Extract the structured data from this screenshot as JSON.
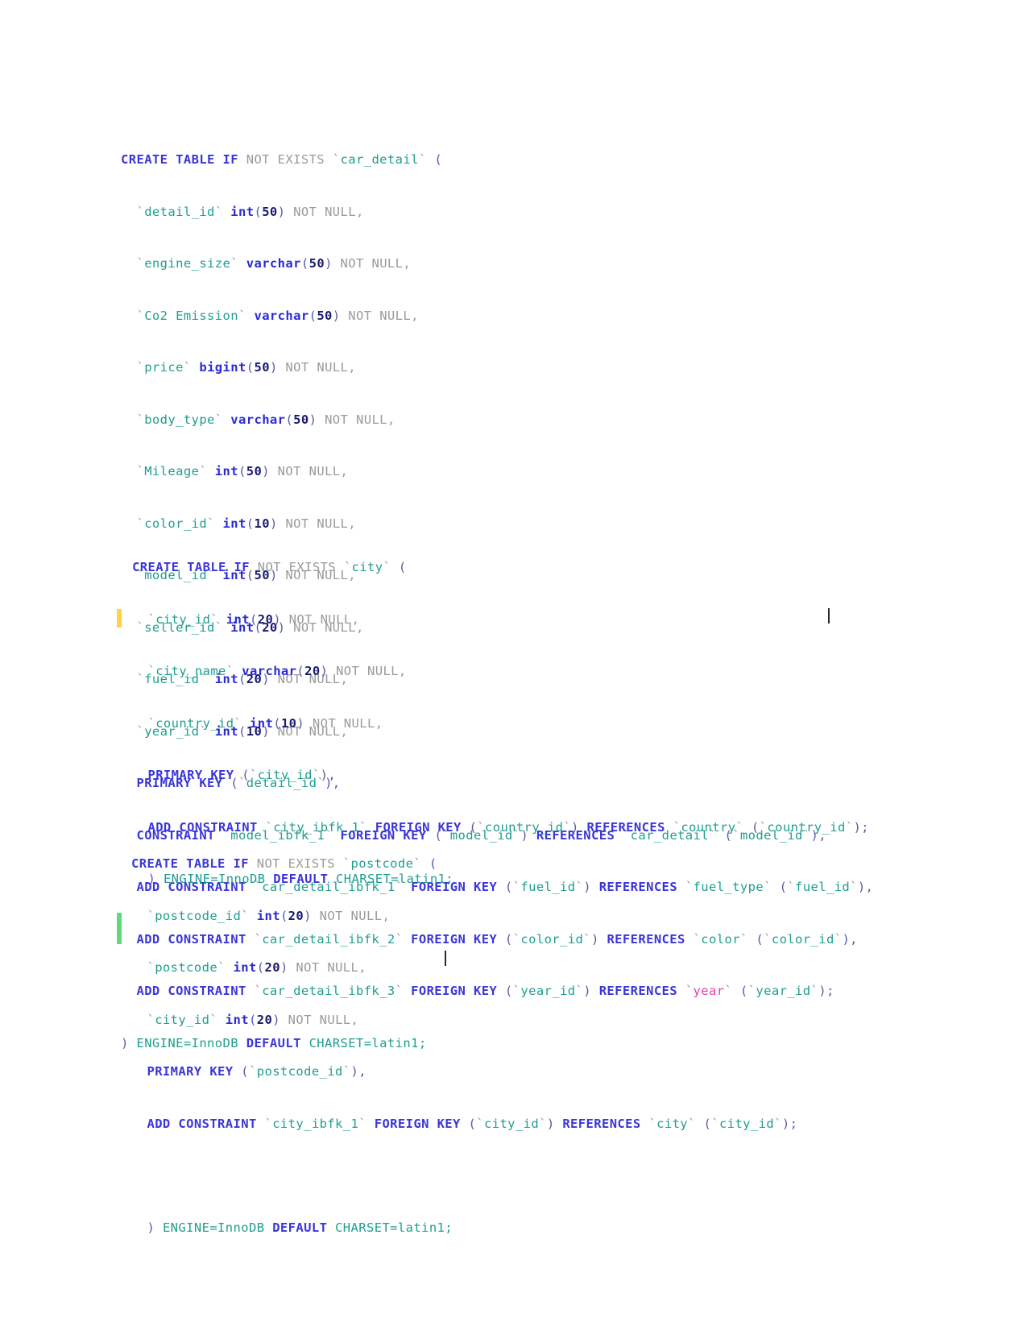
{
  "app": {
    "type": "sql-code-editor",
    "language": "MySQL",
    "background": "#ffffff"
  },
  "theme": {
    "keyword": "#3b36d8",
    "identifier": "#1f9e8f",
    "datatype": "#2b2bd4",
    "number": "#1a1a6e",
    "comment_dim": "#9a9a9a",
    "reserved_word": "#e83ea8",
    "marker_modified": "#ffd24a",
    "marker_added": "#5fd97a",
    "caret": "#2a2a2a"
  },
  "blocks": [
    {
      "name": "car_detail",
      "lines": [
        "CREATE TABLE IF NOT EXISTS `car_detail` (",
        "  `detail_id` int(50) NOT NULL,",
        "  `engine_size` varchar(50) NOT NULL,",
        "  `Co2 Emission` varchar(50) NOT NULL,",
        "  `price` bigint(50) NOT NULL,",
        "  `body_type` varchar(50) NOT NULL,",
        "  `Mileage` int(50) NOT NULL,",
        "  `color_id` int(10) NOT NULL,",
        "  `model_id` int(50) NOT NULL,",
        "  `seller_id` int(20) NOT NULL,",
        "  `fuel_id` int(20) NOT NULL,",
        "  `year_id` int(10) NOT NULL,",
        "  PRIMARY KEY (`detail_id`),",
        "  CONSTRAINT `model_ibfk_1` FOREIGN KEY (`model_id`) REFERENCES `car_detail` (`model_id`),",
        "  ADD CONSTRAINT `car_detail_ibfk_1` FOREIGN KEY (`fuel_id`) REFERENCES `fuel_type` (`fuel_id`),",
        "  ADD CONSTRAINT `car_detail_ibfk_2` FOREIGN KEY (`color_id`) REFERENCES `color` (`color_id`),",
        "  ADD CONSTRAINT `car_detail_ibfk_3` FOREIGN KEY (`year_id`) REFERENCES `year` (`year_id`);",
        ") ENGINE=InnoDB DEFAULT CHARSET=latin1;"
      ]
    },
    {
      "name": "city",
      "lines": [
        "CREATE TABLE IF NOT EXISTS `city` (",
        "  `city_id` int(20) NOT NULL,",
        "  `city_name` varchar(20) NOT NULL,",
        "  `country_id` int(10) NOT NULL,",
        "  PRIMARY KEY (`city_id`),",
        "  ADD CONSTRAINT `city_ibfk_1` FOREIGN KEY (`country_id`) REFERENCES `country` (`country_id`);",
        "  ) ENGINE=InnoDB DEFAULT CHARSET=latin1;"
      ]
    },
    {
      "name": "postcode",
      "lines": [
        "CREATE TABLE IF NOT EXISTS `postcode` (",
        "  `postcode_id` int(20) NOT NULL,",
        "  `postcode` int(20) NOT NULL,",
        "  `city_id` int(20) NOT NULL,",
        "  PRIMARY KEY (`postcode_id`),",
        "  ADD CONSTRAINT `city_ibfk_1` FOREIGN KEY (`city_id`) REFERENCES `city` (`city_id`);",
        "",
        "  ) ENGINE=InnoDB DEFAULT CHARSET=latin1;"
      ]
    }
  ],
  "gutter_markers": [
    {
      "name": "modified-line-marker",
      "color": "#ffd24a",
      "block": "city",
      "line_index": 5
    },
    {
      "name": "added-line-marker",
      "color": "#5fd97a",
      "block": "postcode",
      "line_index": 5
    }
  ],
  "carets": [
    {
      "name": "caret-city-block",
      "block": "city",
      "line_index": 5
    },
    {
      "name": "caret-postcode-block",
      "block": "postcode",
      "line_index": 7
    }
  ],
  "tokens": {
    "keywords": [
      "CREATE",
      "TABLE",
      "IF",
      "PRIMARY",
      "KEY",
      "CONSTRAINT",
      "ADD",
      "FOREIGN",
      "REFERENCES",
      "DEFAULT"
    ],
    "dim_words": [
      "NOT",
      "EXISTS",
      "NULL"
    ],
    "datatypes": [
      "int",
      "varchar",
      "bigint"
    ],
    "reserved_highlighted": [
      "year"
    ],
    "trailer": "ENGINE=InnoDB DEFAULT CHARSET=latin1;"
  }
}
